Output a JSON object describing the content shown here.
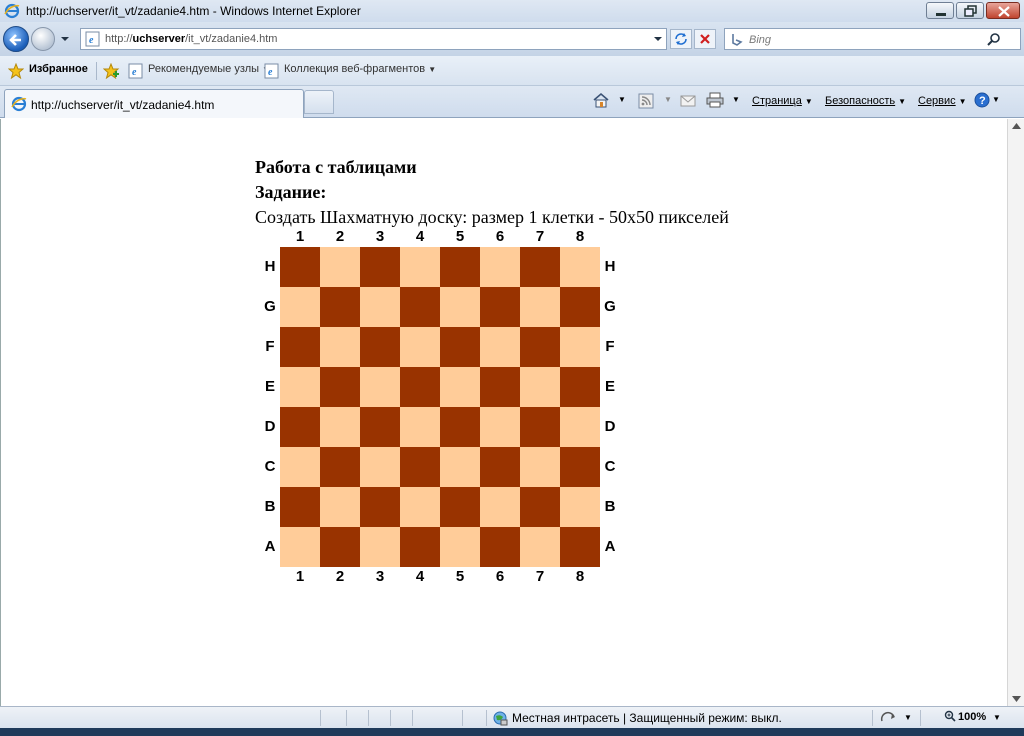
{
  "window": {
    "title": "http://uchserver/it_vt/zadanie4.htm - Windows Internet Explorer"
  },
  "address_bar": {
    "url_prefix": "http://",
    "url_host": "uchserver",
    "url_path": "/it_vt/zadanie4.htm"
  },
  "search": {
    "placeholder": "Bing"
  },
  "favorites_bar": {
    "favorites_label": "Избранное",
    "items": [
      "Рекомендуемые узлы",
      "Коллекция веб-фрагментов"
    ]
  },
  "tab": {
    "label": "http://uchserver/it_vt/zadanie4.htm"
  },
  "command_bar": {
    "page": "Страница",
    "safety": "Безопасность",
    "tools": "Сервис"
  },
  "page": {
    "heading1": "Работа с таблицами",
    "heading2": "Задание:",
    "task": "Создать Шахматную доску: размер 1 клетки - 50x50 пикселей",
    "columns": [
      "1",
      "2",
      "3",
      "4",
      "5",
      "6",
      "7",
      "8"
    ],
    "rows": [
      "H",
      "G",
      "F",
      "E",
      "D",
      "C",
      "B",
      "A"
    ],
    "colors": {
      "dark": "#993300",
      "light": "#ffcc99"
    }
  },
  "status_bar": {
    "zone": "Местная интрасеть | Защищенный режим: выкл.",
    "zoom": "100%"
  }
}
